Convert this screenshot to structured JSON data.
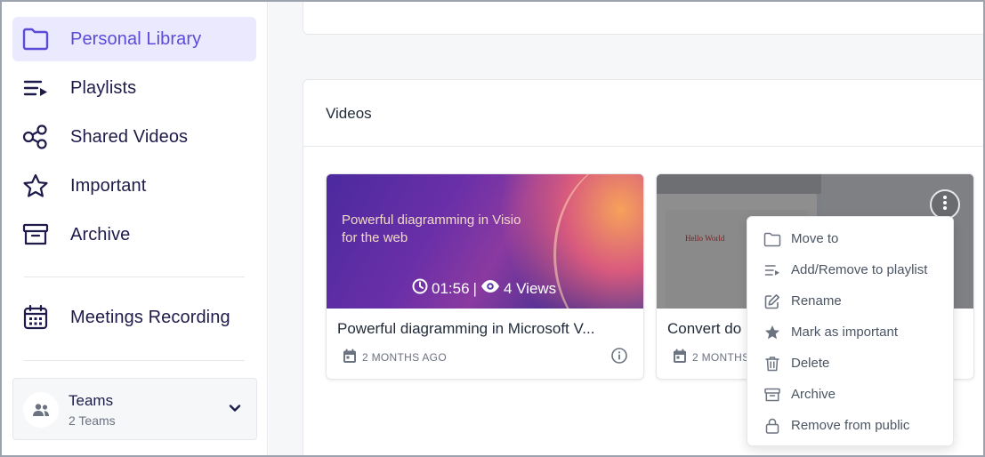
{
  "sidebar": {
    "items": [
      {
        "label": "Personal Library",
        "icon": "folder-icon",
        "active": true
      },
      {
        "label": "Playlists",
        "icon": "playlist-icon"
      },
      {
        "label": "Shared Videos",
        "icon": "share-icon"
      },
      {
        "label": "Important",
        "icon": "star-icon"
      },
      {
        "label": "Archive",
        "icon": "archive-icon"
      },
      {
        "label": "Meetings Recording",
        "icon": "calendar-icon"
      }
    ],
    "teams": {
      "title": "Teams",
      "subtitle": "2 Teams"
    }
  },
  "main": {
    "videos_title": "Videos",
    "videos": [
      {
        "thumb_title": "Powerful diagramming in Visio for the web",
        "duration": "01:56",
        "separator": "|",
        "views": "4 Views",
        "title": "Powerful diagramming in Microsoft V...",
        "date": "2 MONTHS AGO"
      },
      {
        "thumb_text": "Hello World",
        "title": "Convert do",
        "date": "2 MONTHS"
      }
    ]
  },
  "menu": {
    "items": [
      {
        "label": "Move to",
        "icon": "folder-icon"
      },
      {
        "label": "Add/Remove to playlist",
        "icon": "playlist-icon"
      },
      {
        "label": "Rename",
        "icon": "pencil-icon"
      },
      {
        "label": "Mark as important",
        "icon": "star-filled-icon"
      },
      {
        "label": "Delete",
        "icon": "trash-icon"
      },
      {
        "label": "Archive",
        "icon": "archive-icon"
      },
      {
        "label": "Remove from public",
        "icon": "lock-icon"
      }
    ]
  },
  "colors": {
    "accent": "#5b4bd8",
    "active_bg": "#ebe9fe",
    "nav_text": "#1e1b4b",
    "muted": "#6b7280"
  }
}
